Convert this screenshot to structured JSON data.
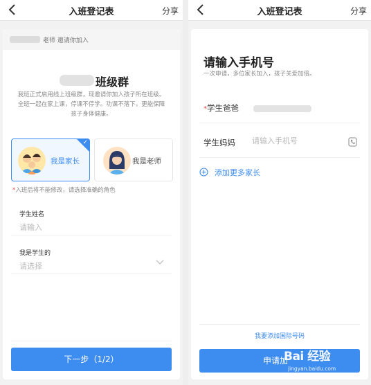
{
  "left": {
    "header": {
      "title": "入班登记表",
      "share": "分享"
    },
    "invite": {
      "text": "老师 邀请你加入"
    },
    "class_name": "班级群",
    "description": "我班正式启用线上班级群，现邀请你加入孩子所在班级。全班一起在家上课，停课不停学。功课不落下，更能保障孩子身体健康。",
    "roles": [
      {
        "label": "我是家长",
        "selected": true
      },
      {
        "label": "我是老师",
        "selected": false
      }
    ],
    "notice_star": "*",
    "notice": "入班后将不能修改，请选择准确的角色",
    "fields": {
      "name": {
        "label": "学生姓名",
        "placeholder": "请输入"
      },
      "relation": {
        "label": "我是学生的",
        "placeholder": "请选择"
      }
    },
    "next_button": "下一步（1/2）"
  },
  "right": {
    "header": {
      "title": "入班登记表",
      "share": "分享"
    },
    "title": "请输入手机号",
    "subtitle": "一次申请，多位家长加入，孩子关爱加倍。",
    "dad": {
      "star": "*",
      "label": "学生爸爸"
    },
    "mom": {
      "label": "学生妈妈",
      "placeholder": "请输入手机号"
    },
    "add_more": "添加更多家长",
    "intl_link": "我要添加国际号码",
    "apply_button": "申请加",
    "watermark": {
      "logo": "Bai 经验",
      "url": "jingyan.baidu.com"
    }
  },
  "colors": {
    "accent": "#3d8cf0",
    "required": "#e94a4a"
  }
}
